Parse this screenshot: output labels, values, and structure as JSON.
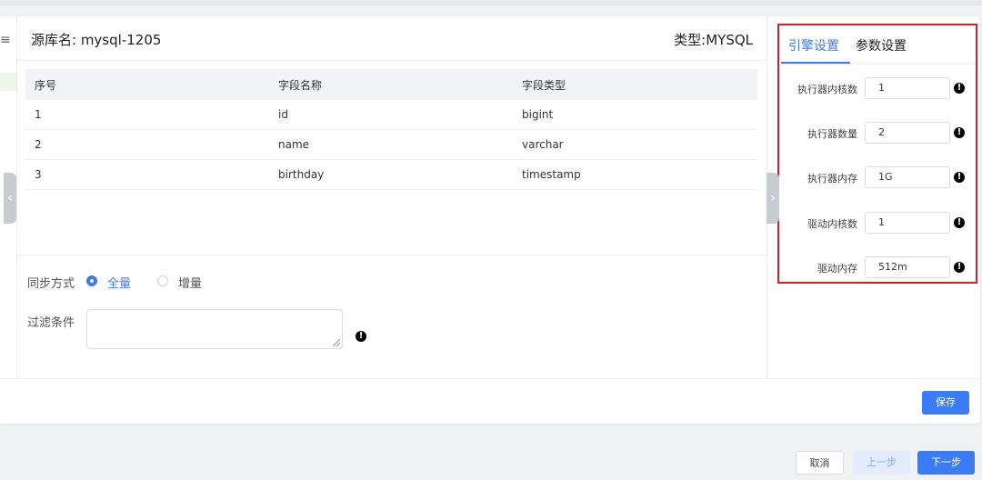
{
  "header": {
    "source_label": "源库名: mysql-1205",
    "type_label": "类型:MYSQL"
  },
  "left_strip": {
    "glyph": "≡"
  },
  "table": {
    "columns": [
      "序号",
      "字段名称",
      "字段类型"
    ],
    "rows": [
      [
        "1",
        "id",
        "bigint"
      ],
      [
        "2",
        "name",
        "varchar"
      ],
      [
        "3",
        "birthday",
        "timestamp"
      ]
    ]
  },
  "sync": {
    "label": "同步方式",
    "options": [
      "全量",
      "增量"
    ],
    "selected": "全量"
  },
  "filter": {
    "label": "过滤条件",
    "value": ""
  },
  "side_panel": {
    "tabs": [
      "引擎设置",
      "参数设置"
    ],
    "active_tab": "引擎设置",
    "fields": [
      {
        "label": "执行器内核数",
        "value": "1"
      },
      {
        "label": "执行器数量",
        "value": "2"
      },
      {
        "label": "执行器内存",
        "value": "1G"
      },
      {
        "label": "驱动内核数",
        "value": "1"
      },
      {
        "label": "驱动内存",
        "value": "512m"
      }
    ]
  },
  "icons": {
    "info": "info-icon",
    "left_arrow": "chevron-left-icon",
    "right_arrow": "chevron-right-icon"
  },
  "colors": {
    "accent": "#3a7bf6",
    "highlight_border": "#d0212b"
  },
  "buttons": {
    "save": "保存",
    "cancel": "取消",
    "prev": "上一步",
    "next": "下一步"
  }
}
